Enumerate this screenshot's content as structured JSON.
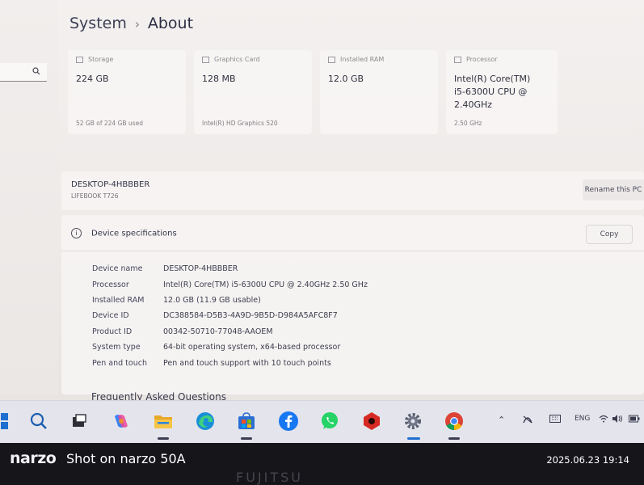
{
  "breadcrumb": {
    "parent": "System",
    "separator": "›",
    "current": "About"
  },
  "cards": [
    {
      "title": "Storage",
      "value": "224 GB",
      "sub": "52 GB of 224 GB used",
      "icon": "storage-icon"
    },
    {
      "title": "Graphics Card",
      "value": "128 MB",
      "sub": "Intel(R) HD Graphics 520",
      "icon": "graphics-card-icon"
    },
    {
      "title": "Installed RAM",
      "value": "12.0 GB",
      "sub": "",
      "icon": "ram-icon"
    },
    {
      "title": "Processor",
      "value": "Intel(R) Core(TM) i5-6300U CPU @ 2.40GHz",
      "sub": "2.50 GHz",
      "icon": "processor-icon"
    }
  ],
  "pc": {
    "name": "DESKTOP-4HBBBER",
    "model": "LIFEBOOK T726",
    "rename_label": "Rename this PC"
  },
  "spec": {
    "heading": "Device specifications",
    "copy_label": "Copy",
    "rows": [
      {
        "key": "Device name",
        "value": "DESKTOP-4HBBBER"
      },
      {
        "key": "Processor",
        "value": "Intel(R) Core(TM) i5-6300U CPU @ 2.40GHz   2.50 GHz"
      },
      {
        "key": "Installed RAM",
        "value": "12.0 GB (11.9 GB usable)"
      },
      {
        "key": "Device ID",
        "value": "DC388584-D5B3-4A9D-9B5D-D984A5AFC8F7"
      },
      {
        "key": "Product ID",
        "value": "00342-50710-77048-AAOEM"
      },
      {
        "key": "System type",
        "value": "64-bit operating system, x64-based processor"
      },
      {
        "key": "Pen and touch",
        "value": "Pen and touch support with 10 touch points"
      }
    ]
  },
  "faq_heading": "Frequently Asked Questions",
  "taskbar": {
    "apps": [
      "start-icon",
      "search-icon",
      "task-view-icon",
      "copilot-icon",
      "file-explorer-icon",
      "edge-icon",
      "store-icon",
      "facebook-icon",
      "whatsapp-icon",
      "red-app-icon",
      "settings-icon",
      "chrome-icon"
    ],
    "tray_language": "ENG"
  },
  "watermark": {
    "brand": "narzo",
    "shot_text": "Shot on narzo 50A",
    "datetime": "2025.06.23 19:14",
    "laptop_brand": "FUJITSU"
  },
  "colors": {
    "accent": "#0067c0",
    "facebook": "#1877f2",
    "whatsapp": "#25d366"
  }
}
